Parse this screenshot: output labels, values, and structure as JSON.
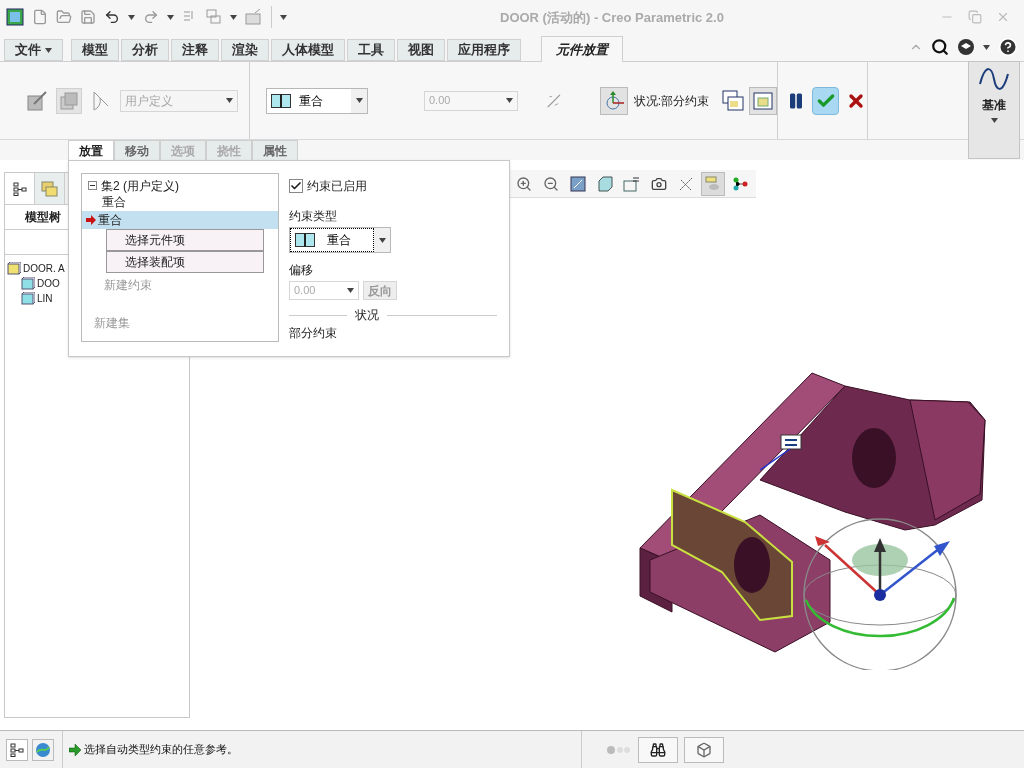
{
  "window": {
    "title": "DOOR (活动的) - Creo Parametric 2.0"
  },
  "ribbon_tabs": [
    {
      "label": "文件",
      "kind": "menu",
      "selected": false
    },
    {
      "label": "模型",
      "kind": "tab",
      "selected": false
    },
    {
      "label": "分析",
      "kind": "tab",
      "selected": false
    },
    {
      "label": "注释",
      "kind": "tab",
      "selected": false
    },
    {
      "label": "渲染",
      "kind": "tab",
      "selected": false
    },
    {
      "label": "人体模型",
      "kind": "tab",
      "selected": false
    },
    {
      "label": "工具",
      "kind": "tab",
      "selected": false
    },
    {
      "label": "视图",
      "kind": "tab",
      "selected": false
    },
    {
      "label": "应用程序",
      "kind": "tab",
      "selected": false
    },
    {
      "label": "元件放置",
      "kind": "tab",
      "selected": true
    }
  ],
  "ribbon": {
    "set_type": {
      "value": "用户定义",
      "disabled": true
    },
    "constraint_type": {
      "value": "重合"
    },
    "offset": {
      "value": "0.00",
      "disabled": true
    },
    "status": "状况:部分约束",
    "datum_label": "基准"
  },
  "sub_tabs": [
    {
      "label": "放置",
      "selected": true,
      "disabled": false
    },
    {
      "label": "移动",
      "selected": false,
      "disabled": false
    },
    {
      "label": "选项",
      "selected": false,
      "disabled": true
    },
    {
      "label": "挠性",
      "selected": false,
      "disabled": true
    },
    {
      "label": "属性",
      "selected": false,
      "disabled": false
    }
  ],
  "placement_panel": {
    "set": {
      "label": "集2 (用户定义)",
      "expanded": true,
      "children": [
        {
          "label": "重合",
          "selected": false
        },
        {
          "label": "重合",
          "selected": true
        }
      ]
    },
    "selectors": [
      "选择元件项",
      "选择装配项"
    ],
    "new_constraint": {
      "label": "新建约束",
      "disabled": true
    },
    "new_set": {
      "label": "新建集",
      "disabled": true
    },
    "constraint_enabled": {
      "label": "约束已启用",
      "checked": true
    },
    "constraint_type_label": "约束类型",
    "constraint_type": "重合",
    "offset_label": "偏移",
    "offset_value": "0.00",
    "flip_button": "反向",
    "status_heading": "状况",
    "status": "部分约束"
  },
  "navigator_tabs": [
    {
      "selected": true
    },
    {
      "selected": false
    }
  ],
  "model_tree": {
    "title": "模型树",
    "items": [
      {
        "label": "DOOR. A",
        "children": [
          {
            "label": "DOO"
          },
          {
            "label": "LIN"
          }
        ]
      }
    ]
  },
  "status_bar": {
    "message": "选择自动类型约束的任意参考。"
  }
}
